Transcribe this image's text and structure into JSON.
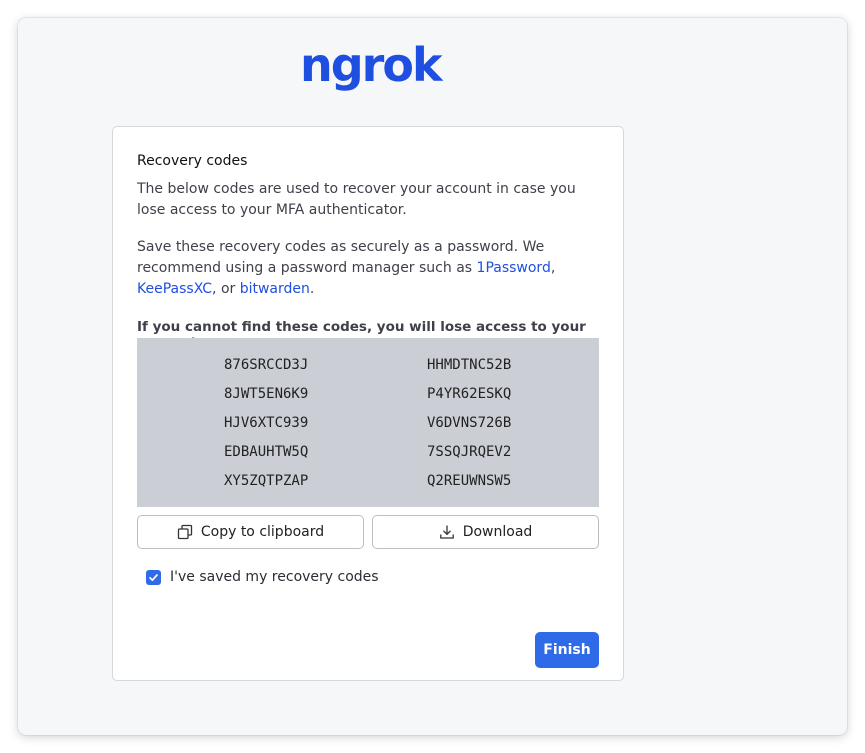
{
  "brand": {
    "logo_text": "ngrok",
    "color": "#1f4fe0"
  },
  "card": {
    "title": "Recovery codes",
    "intro": "The below codes are used to recover your account in case you lose access to your MFA authenticator.",
    "save_text_before": "Save these recovery codes as securely as a password. We recommend using a password manager such as ",
    "links": [
      "1Password",
      "KeePassXC",
      "bitwarden"
    ],
    "sep1": ", ",
    "sep2": ", or ",
    "period": ".",
    "warning": "If you cannot find these codes, you will lose access to your account."
  },
  "codes": {
    "left": [
      "876SRCCD3J",
      "8JWT5EN6K9",
      "HJV6XTC939",
      "EDBAUHTW5Q",
      "XY5ZQTPZAP"
    ],
    "right": [
      "HHMDTNC52B",
      "P4YR62ESKQ",
      "V6DVNS726B",
      "7SSQJRQEV2",
      "Q2REUWNSW5"
    ]
  },
  "actions": {
    "copy_label": "Copy to clipboard",
    "download_label": "Download",
    "copy_icon": "copy-icon",
    "download_icon": "download-icon"
  },
  "checkbox": {
    "label": "I've saved my recovery codes",
    "checked": true
  },
  "finish_label": "Finish",
  "colors": {
    "accent": "#2f6be8",
    "codes_bg": "#cbcfd5"
  }
}
